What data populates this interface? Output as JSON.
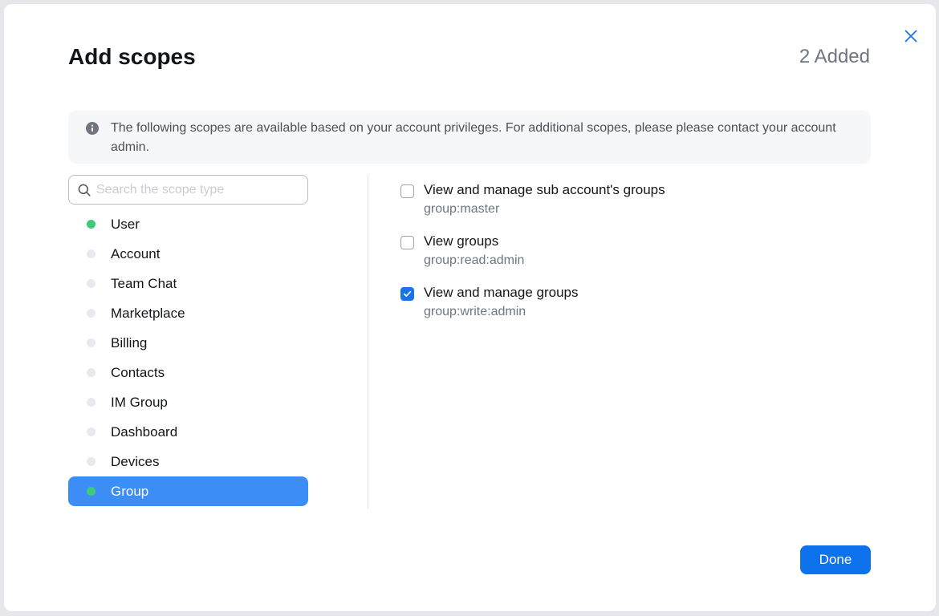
{
  "dialog": {
    "title": "Add scopes",
    "added_count": "2 Added",
    "info_text": "The following scopes are available based on your account privileges. For additional scopes, please please contact your account admin.",
    "done_label": "Done"
  },
  "search": {
    "placeholder": "Search the scope type",
    "value": ""
  },
  "categories": [
    {
      "label": "User",
      "has_selection": true
    },
    {
      "label": "Account",
      "has_selection": false
    },
    {
      "label": "Team Chat",
      "has_selection": false
    },
    {
      "label": "Marketplace",
      "has_selection": false
    },
    {
      "label": "Billing",
      "has_selection": false
    },
    {
      "label": "Contacts",
      "has_selection": false
    },
    {
      "label": "IM Group",
      "has_selection": false
    },
    {
      "label": "Dashboard",
      "has_selection": false
    },
    {
      "label": "Devices",
      "has_selection": false
    },
    {
      "label": "Group",
      "has_selection": true,
      "selected": true
    }
  ],
  "scopes": [
    {
      "title": "View and manage sub account's groups",
      "code": "group:master",
      "checked": false
    },
    {
      "title": "View groups",
      "code": "group:read:admin",
      "checked": false
    },
    {
      "title": "View and manage groups",
      "code": "group:write:admin",
      "checked": true
    }
  ],
  "colors": {
    "primary": "#0e72ed",
    "active_category": "#3c8ef6",
    "selection_dot": "#3fc97a",
    "inactive_dot": "#e8e9f0"
  },
  "icons": [
    "close-icon",
    "info-icon",
    "search-icon",
    "check-icon"
  ]
}
